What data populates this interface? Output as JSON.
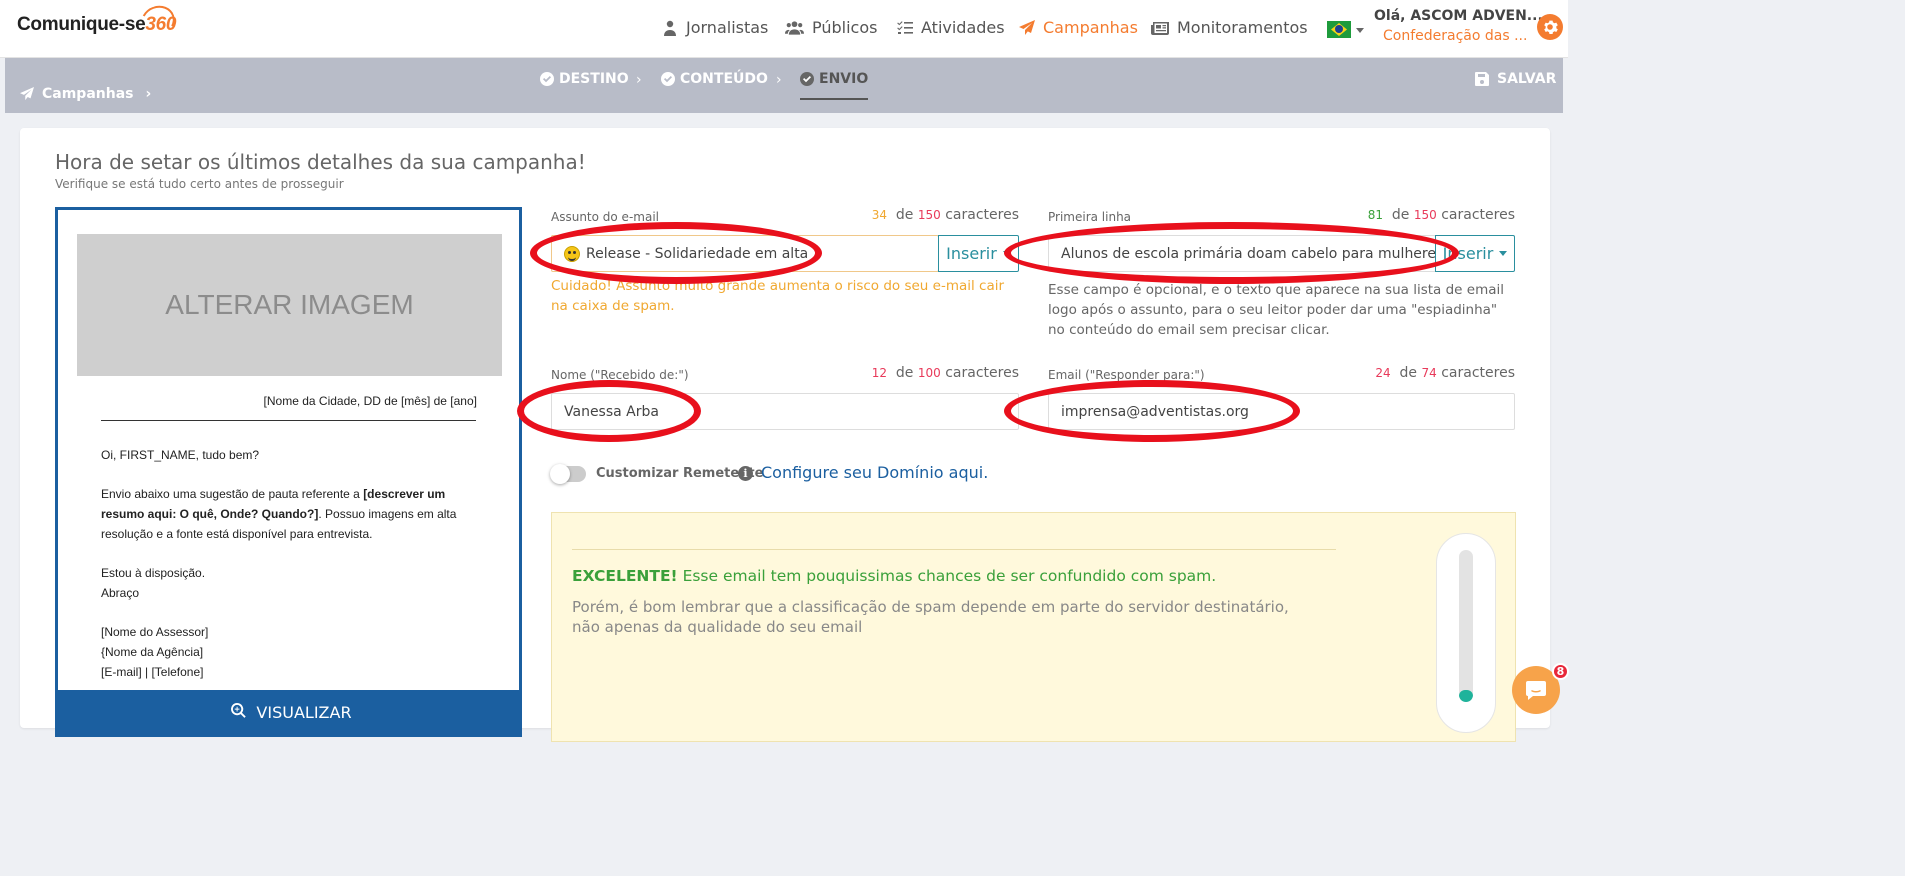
{
  "header": {
    "logo": {
      "brand": "Comunique-se",
      "num": "360"
    },
    "nav": [
      {
        "label": "Jornalistas",
        "icon": "user-icon"
      },
      {
        "label": "Públicos",
        "icon": "users-icon"
      },
      {
        "label": "Atividades",
        "icon": "tasks-icon"
      },
      {
        "label": "Campanhas",
        "icon": "paper-plane-icon",
        "active": true
      },
      {
        "label": "Monitoramentos",
        "icon": "newspaper-icon"
      }
    ],
    "user": {
      "greeting": "Olá, ASCOM ADVEN...",
      "org": "Confederação das ..."
    }
  },
  "subbar": {
    "breadcrumb": "Campanhas",
    "steps": [
      "DESTINO",
      "CONTEÚDO",
      "ENVIO"
    ],
    "save_label": "SALVAR"
  },
  "page": {
    "title": "Hora de setar os últimos detalhes da sua campanha!",
    "subtitle": "Verifique se está tudo certo antes de prosseguir"
  },
  "preview": {
    "image_placeholder": "ALTERAR IMAGEM",
    "city_line": "[Nome da Cidade, DD de [mês] de [ano]",
    "greeting": "Oi, FIRST_NAME, tudo bem?",
    "para_start": "Envio abaixo uma sugestão de pauta referente a ",
    "para_bold": "[descrever um resumo aqui: O quê, Onde? Quando?]",
    "para_end": ". Possuo imagens em alta resolução e a fonte está disponível para entrevista.",
    "closing1": "Estou à disposição.",
    "closing2": "Abraço",
    "sig1": "[Nome do Assessor]",
    "sig2": "{Nome da Agência]",
    "sig3": "[E-mail] | [Telefone]",
    "button": "VISUALIZAR"
  },
  "form": {
    "subject": {
      "label": "Assunto do e-mail",
      "count": "34",
      "of": "de",
      "max": "150",
      "unit": "caracteres",
      "value": "Release - Solidariedade em alta",
      "insert": "Inserir",
      "warning": "Cuidado! Assunto muito grande aumenta o risco do seu e-mail cair na caixa de spam."
    },
    "first_line": {
      "label": "Primeira linha",
      "count": "81",
      "of": "de",
      "max": "150",
      "unit": "caracteres",
      "value": "Alunos de escola primária doam cabelo para mulheres e",
      "insert": "Inserir",
      "help": "Esse campo é opcional, e o texto que aparece na sua lista de email logo após o assunto, para o seu leitor poder dar uma \"espiadinha\" no conteúdo do email sem precisar clicar."
    },
    "sender_name": {
      "label": "Nome (\"Recebido de:\")",
      "count": "12",
      "of": "de",
      "max": "100",
      "unit": "caracteres",
      "value": "Vanessa Arba"
    },
    "reply_to": {
      "label": "Email (\"Responder para:\")",
      "count": "24",
      "of": "de",
      "max": "74",
      "unit": "caracteres",
      "value": "imprensa@adventistas.org"
    },
    "custom_sender": {
      "label": "Customizar Remetente",
      "enabled": false
    },
    "domain_link": "Configure seu Domínio aqui."
  },
  "spam": {
    "status": "EXCELENTE!",
    "message": "Esse email tem pouquissimas chances de ser confundido com spam.",
    "note": "Porém, é bom lembrar que a classificação de spam depende em parte do servidor destinatário, não apenas da qualidade do seu email",
    "score_fraction": 0.08
  },
  "chat": {
    "badge": "8"
  },
  "colors": {
    "accent": "#f47c30",
    "primary": "#1b5fa0",
    "teal": "#2a8f9e",
    "annotation": "#e8101c",
    "success": "#3aa03a",
    "warning": "#f0a830"
  }
}
